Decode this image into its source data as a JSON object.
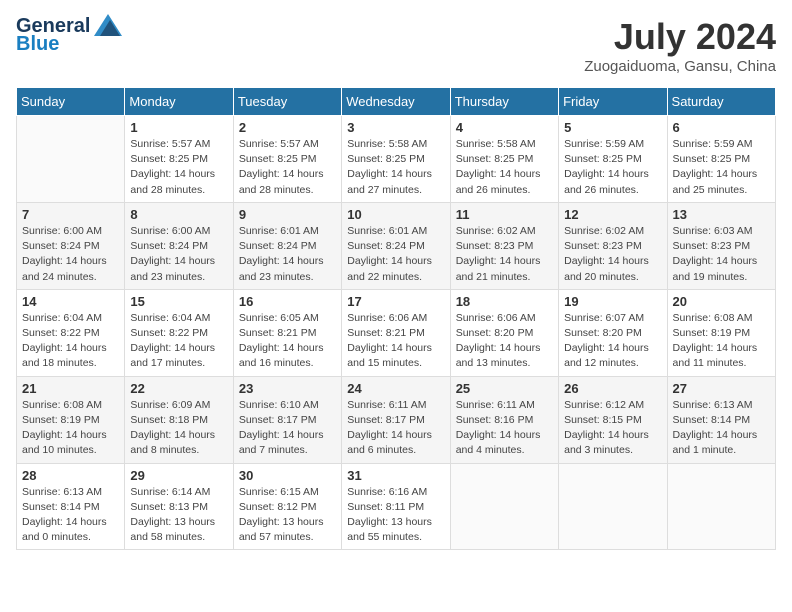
{
  "header": {
    "logo_line1": "General",
    "logo_line2": "Blue",
    "month_year": "July 2024",
    "location": "Zuogaiduoma, Gansu, China"
  },
  "calendar": {
    "days_of_week": [
      "Sunday",
      "Monday",
      "Tuesday",
      "Wednesday",
      "Thursday",
      "Friday",
      "Saturday"
    ],
    "weeks": [
      [
        {
          "day": "",
          "info": ""
        },
        {
          "day": "1",
          "info": "Sunrise: 5:57 AM\nSunset: 8:25 PM\nDaylight: 14 hours\nand 28 minutes."
        },
        {
          "day": "2",
          "info": "Sunrise: 5:57 AM\nSunset: 8:25 PM\nDaylight: 14 hours\nand 28 minutes."
        },
        {
          "day": "3",
          "info": "Sunrise: 5:58 AM\nSunset: 8:25 PM\nDaylight: 14 hours\nand 27 minutes."
        },
        {
          "day": "4",
          "info": "Sunrise: 5:58 AM\nSunset: 8:25 PM\nDaylight: 14 hours\nand 26 minutes."
        },
        {
          "day": "5",
          "info": "Sunrise: 5:59 AM\nSunset: 8:25 PM\nDaylight: 14 hours\nand 26 minutes."
        },
        {
          "day": "6",
          "info": "Sunrise: 5:59 AM\nSunset: 8:25 PM\nDaylight: 14 hours\nand 25 minutes."
        }
      ],
      [
        {
          "day": "7",
          "info": ""
        },
        {
          "day": "8",
          "info": "Sunrise: 6:00 AM\nSunset: 8:24 PM\nDaylight: 14 hours\nand 23 minutes."
        },
        {
          "day": "9",
          "info": "Sunrise: 6:01 AM\nSunset: 8:24 PM\nDaylight: 14 hours\nand 23 minutes."
        },
        {
          "day": "10",
          "info": "Sunrise: 6:01 AM\nSunset: 8:24 PM\nDaylight: 14 hours\nand 22 minutes."
        },
        {
          "day": "11",
          "info": "Sunrise: 6:02 AM\nSunset: 8:23 PM\nDaylight: 14 hours\nand 21 minutes."
        },
        {
          "day": "12",
          "info": "Sunrise: 6:02 AM\nSunset: 8:23 PM\nDaylight: 14 hours\nand 20 minutes."
        },
        {
          "day": "13",
          "info": "Sunrise: 6:03 AM\nSunset: 8:23 PM\nDaylight: 14 hours\nand 19 minutes."
        }
      ],
      [
        {
          "day": "14",
          "info": ""
        },
        {
          "day": "15",
          "info": "Sunrise: 6:04 AM\nSunset: 8:22 PM\nDaylight: 14 hours\nand 17 minutes."
        },
        {
          "day": "16",
          "info": "Sunrise: 6:05 AM\nSunset: 8:21 PM\nDaylight: 14 hours\nand 16 minutes."
        },
        {
          "day": "17",
          "info": "Sunrise: 6:06 AM\nSunset: 8:21 PM\nDaylight: 14 hours\nand 15 minutes."
        },
        {
          "day": "18",
          "info": "Sunrise: 6:06 AM\nSunset: 8:20 PM\nDaylight: 14 hours\nand 13 minutes."
        },
        {
          "day": "19",
          "info": "Sunrise: 6:07 AM\nSunset: 8:20 PM\nDaylight: 14 hours\nand 12 minutes."
        },
        {
          "day": "20",
          "info": "Sunrise: 6:08 AM\nSunset: 8:19 PM\nDaylight: 14 hours\nand 11 minutes."
        }
      ],
      [
        {
          "day": "21",
          "info": ""
        },
        {
          "day": "22",
          "info": "Sunrise: 6:09 AM\nSunset: 8:18 PM\nDaylight: 14 hours\nand 8 minutes."
        },
        {
          "day": "23",
          "info": "Sunrise: 6:10 AM\nSunset: 8:17 PM\nDaylight: 14 hours\nand 7 minutes."
        },
        {
          "day": "24",
          "info": "Sunrise: 6:11 AM\nSunset: 8:17 PM\nDaylight: 14 hours\nand 6 minutes."
        },
        {
          "day": "25",
          "info": "Sunrise: 6:11 AM\nSunset: 8:16 PM\nDaylight: 14 hours\nand 4 minutes."
        },
        {
          "day": "26",
          "info": "Sunrise: 6:12 AM\nSunset: 8:15 PM\nDaylight: 14 hours\nand 3 minutes."
        },
        {
          "day": "27",
          "info": "Sunrise: 6:13 AM\nSunset: 8:14 PM\nDaylight: 14 hours\nand 1 minute."
        }
      ],
      [
        {
          "day": "28",
          "info": "Sunrise: 6:13 AM\nSunset: 8:14 PM\nDaylight: 14 hours\nand 0 minutes."
        },
        {
          "day": "29",
          "info": "Sunrise: 6:14 AM\nSunset: 8:13 PM\nDaylight: 13 hours\nand 58 minutes."
        },
        {
          "day": "30",
          "info": "Sunrise: 6:15 AM\nSunset: 8:12 PM\nDaylight: 13 hours\nand 57 minutes."
        },
        {
          "day": "31",
          "info": "Sunrise: 6:16 AM\nSunset: 8:11 PM\nDaylight: 13 hours\nand 55 minutes."
        },
        {
          "day": "",
          "info": ""
        },
        {
          "day": "",
          "info": ""
        },
        {
          "day": "",
          "info": ""
        }
      ]
    ],
    "week1_day7_info": "Sunrise: 6:00 AM\nSunset: 8:24 PM\nDaylight: 14 hours\nand 24 minutes.",
    "week3_day14_info": "Sunrise: 6:04 AM\nSunset: 8:22 PM\nDaylight: 14 hours\nand 18 minutes.",
    "week4_day21_info": "Sunrise: 6:08 AM\nSunset: 8:19 PM\nDaylight: 14 hours\nand 10 minutes."
  }
}
